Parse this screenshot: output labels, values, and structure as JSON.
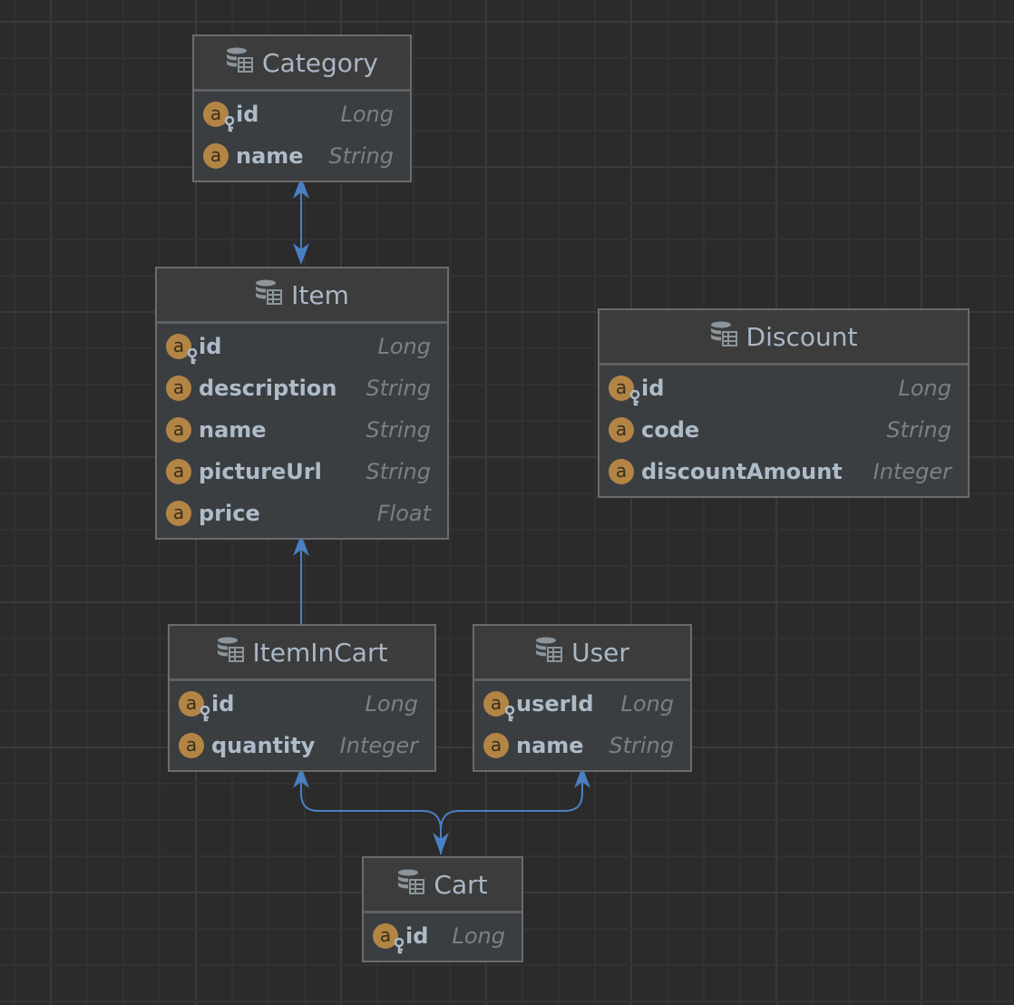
{
  "colors": {
    "background": "#2b2b2b",
    "connector": "#4a7fc4",
    "badge": "#b38545",
    "border": "#6b6b6b"
  },
  "entities": [
    {
      "name": "Category",
      "icon": "database-table-icon",
      "fields": [
        {
          "name": "id",
          "type": "Long",
          "pk": true
        },
        {
          "name": "name",
          "type": "String",
          "pk": false
        }
      ]
    },
    {
      "name": "Item",
      "icon": "database-table-icon",
      "fields": [
        {
          "name": "id",
          "type": "Long",
          "pk": true
        },
        {
          "name": "description",
          "type": "String",
          "pk": false
        },
        {
          "name": "name",
          "type": "String",
          "pk": false
        },
        {
          "name": "pictureUrl",
          "type": "String",
          "pk": false
        },
        {
          "name": "price",
          "type": "Float",
          "pk": false
        }
      ]
    },
    {
      "name": "Discount",
      "icon": "database-table-icon",
      "fields": [
        {
          "name": "id",
          "type": "Long",
          "pk": true
        },
        {
          "name": "code",
          "type": "String",
          "pk": false
        },
        {
          "name": "discountAmount",
          "type": "Integer",
          "pk": false
        }
      ]
    },
    {
      "name": "ItemInCart",
      "icon": "database-table-icon",
      "fields": [
        {
          "name": "id",
          "type": "Long",
          "pk": true
        },
        {
          "name": "quantity",
          "type": "Integer",
          "pk": false
        }
      ]
    },
    {
      "name": "User",
      "icon": "database-table-icon",
      "fields": [
        {
          "name": "userId",
          "type": "Long",
          "pk": true
        },
        {
          "name": "name",
          "type": "String",
          "pk": false
        }
      ]
    },
    {
      "name": "Cart",
      "icon": "database-table-icon",
      "fields": [
        {
          "name": "id",
          "type": "Long",
          "pk": true
        }
      ]
    }
  ],
  "relations": [
    {
      "from": "Category",
      "to": "Item",
      "bidirectional": true
    },
    {
      "from": "ItemInCart",
      "to": "Item",
      "bidirectional": false
    },
    {
      "from": "Cart",
      "to": "ItemInCart",
      "bidirectional": true
    },
    {
      "from": "Cart",
      "to": "User",
      "bidirectional": true
    }
  ]
}
